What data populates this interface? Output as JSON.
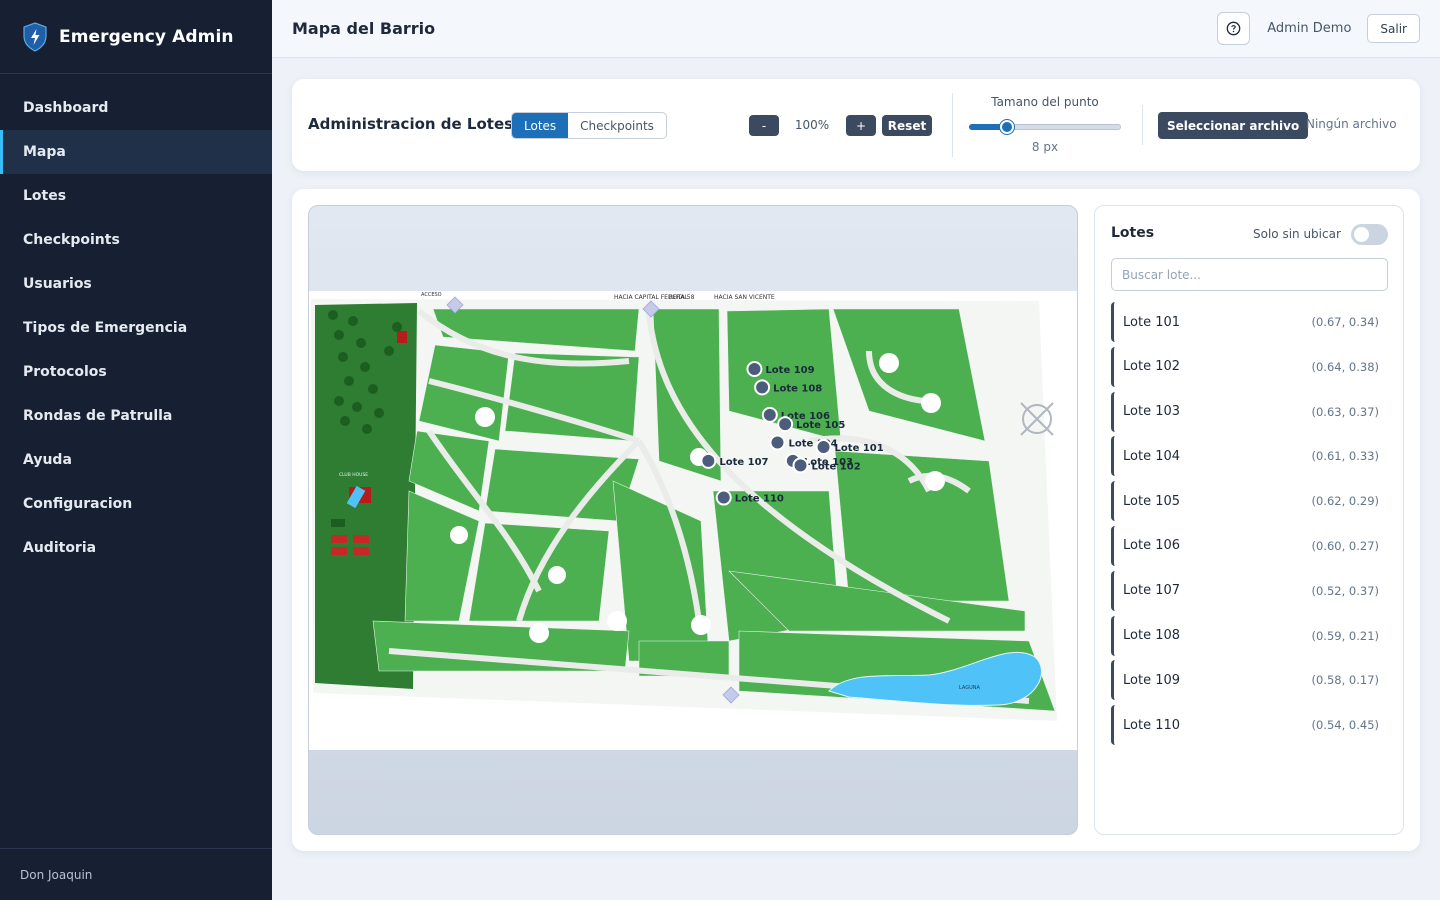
{
  "app": {
    "title": "Emergency Admin",
    "footer_user": "Don Joaquin"
  },
  "sidebar": {
    "items": [
      {
        "label": "Dashboard",
        "active": false
      },
      {
        "label": "Mapa",
        "active": true
      },
      {
        "label": "Lotes",
        "active": false
      },
      {
        "label": "Checkpoints",
        "active": false
      },
      {
        "label": "Usuarios",
        "active": false
      },
      {
        "label": "Tipos de Emergencia",
        "active": false
      },
      {
        "label": "Protocolos",
        "active": false
      },
      {
        "label": "Rondas de Patrulla",
        "active": false
      },
      {
        "label": "Ayuda",
        "active": false
      },
      {
        "label": "Configuracion",
        "active": false
      },
      {
        "label": "Auditoria",
        "active": false
      }
    ]
  },
  "topbar": {
    "title": "Mapa del Barrio",
    "help_icon": "help-circle-icon",
    "user": "Admin Demo",
    "logout_label": "Salir"
  },
  "toolbar": {
    "title": "Administracion de Lotes",
    "tabs": [
      {
        "label": "Lotes",
        "active": true
      },
      {
        "label": "Checkpoints",
        "active": false
      }
    ],
    "zoom_minus": "-",
    "zoom_value": "100%",
    "zoom_plus": "+",
    "reset_label": "Reset",
    "point_size_label": "Tamano del punto",
    "point_size_value": "8 px",
    "point_size_fraction": 0.25,
    "file_button": "Seleccionar archivo",
    "file_status": "Ningún archivo"
  },
  "map": {
    "header_left": "HACIA CAPITAL FEDERAL",
    "header_mid": "RUTA 58",
    "header_right": "HACIA SAN VICENTE",
    "access_label": "ACCESO",
    "lagoon_label": "LAGUNA",
    "club_house": "CLUB HOUSE",
    "markers": [
      {
        "label": "Lote 109"
      },
      {
        "label": "Lote 108"
      },
      {
        "label": "Lote 106"
      },
      {
        "label": "Lote 105"
      },
      {
        "label": "Lote 104"
      },
      {
        "label": "Lote 101"
      },
      {
        "label": "Lote 103"
      },
      {
        "label": "Lote 102"
      },
      {
        "label": "Lote 107"
      },
      {
        "label": "Lote 110"
      }
    ]
  },
  "lots_panel": {
    "title": "Lotes",
    "filter_label": "Solo sin ubicar",
    "filter_on": false,
    "search_placeholder": "Buscar lote...",
    "lots": [
      {
        "name": "Lote 101",
        "coords": "(0.67, 0.34)"
      },
      {
        "name": "Lote 102",
        "coords": "(0.64, 0.38)"
      },
      {
        "name": "Lote 103",
        "coords": "(0.63, 0.37)"
      },
      {
        "name": "Lote 104",
        "coords": "(0.61, 0.33)"
      },
      {
        "name": "Lote 105",
        "coords": "(0.62, 0.29)"
      },
      {
        "name": "Lote 106",
        "coords": "(0.60, 0.27)"
      },
      {
        "name": "Lote 107",
        "coords": "(0.52, 0.37)"
      },
      {
        "name": "Lote 108",
        "coords": "(0.59, 0.21)"
      },
      {
        "name": "Lote 109",
        "coords": "(0.58, 0.17)"
      },
      {
        "name": "Lote 110",
        "coords": "(0.54, 0.45)"
      }
    ]
  },
  "colors": {
    "sidebar_bg": "#172033",
    "accent": "#1d6fb8",
    "button_dark": "#3b4a61",
    "lot_green": "#4caf50",
    "marker": "#4b5d7a"
  }
}
